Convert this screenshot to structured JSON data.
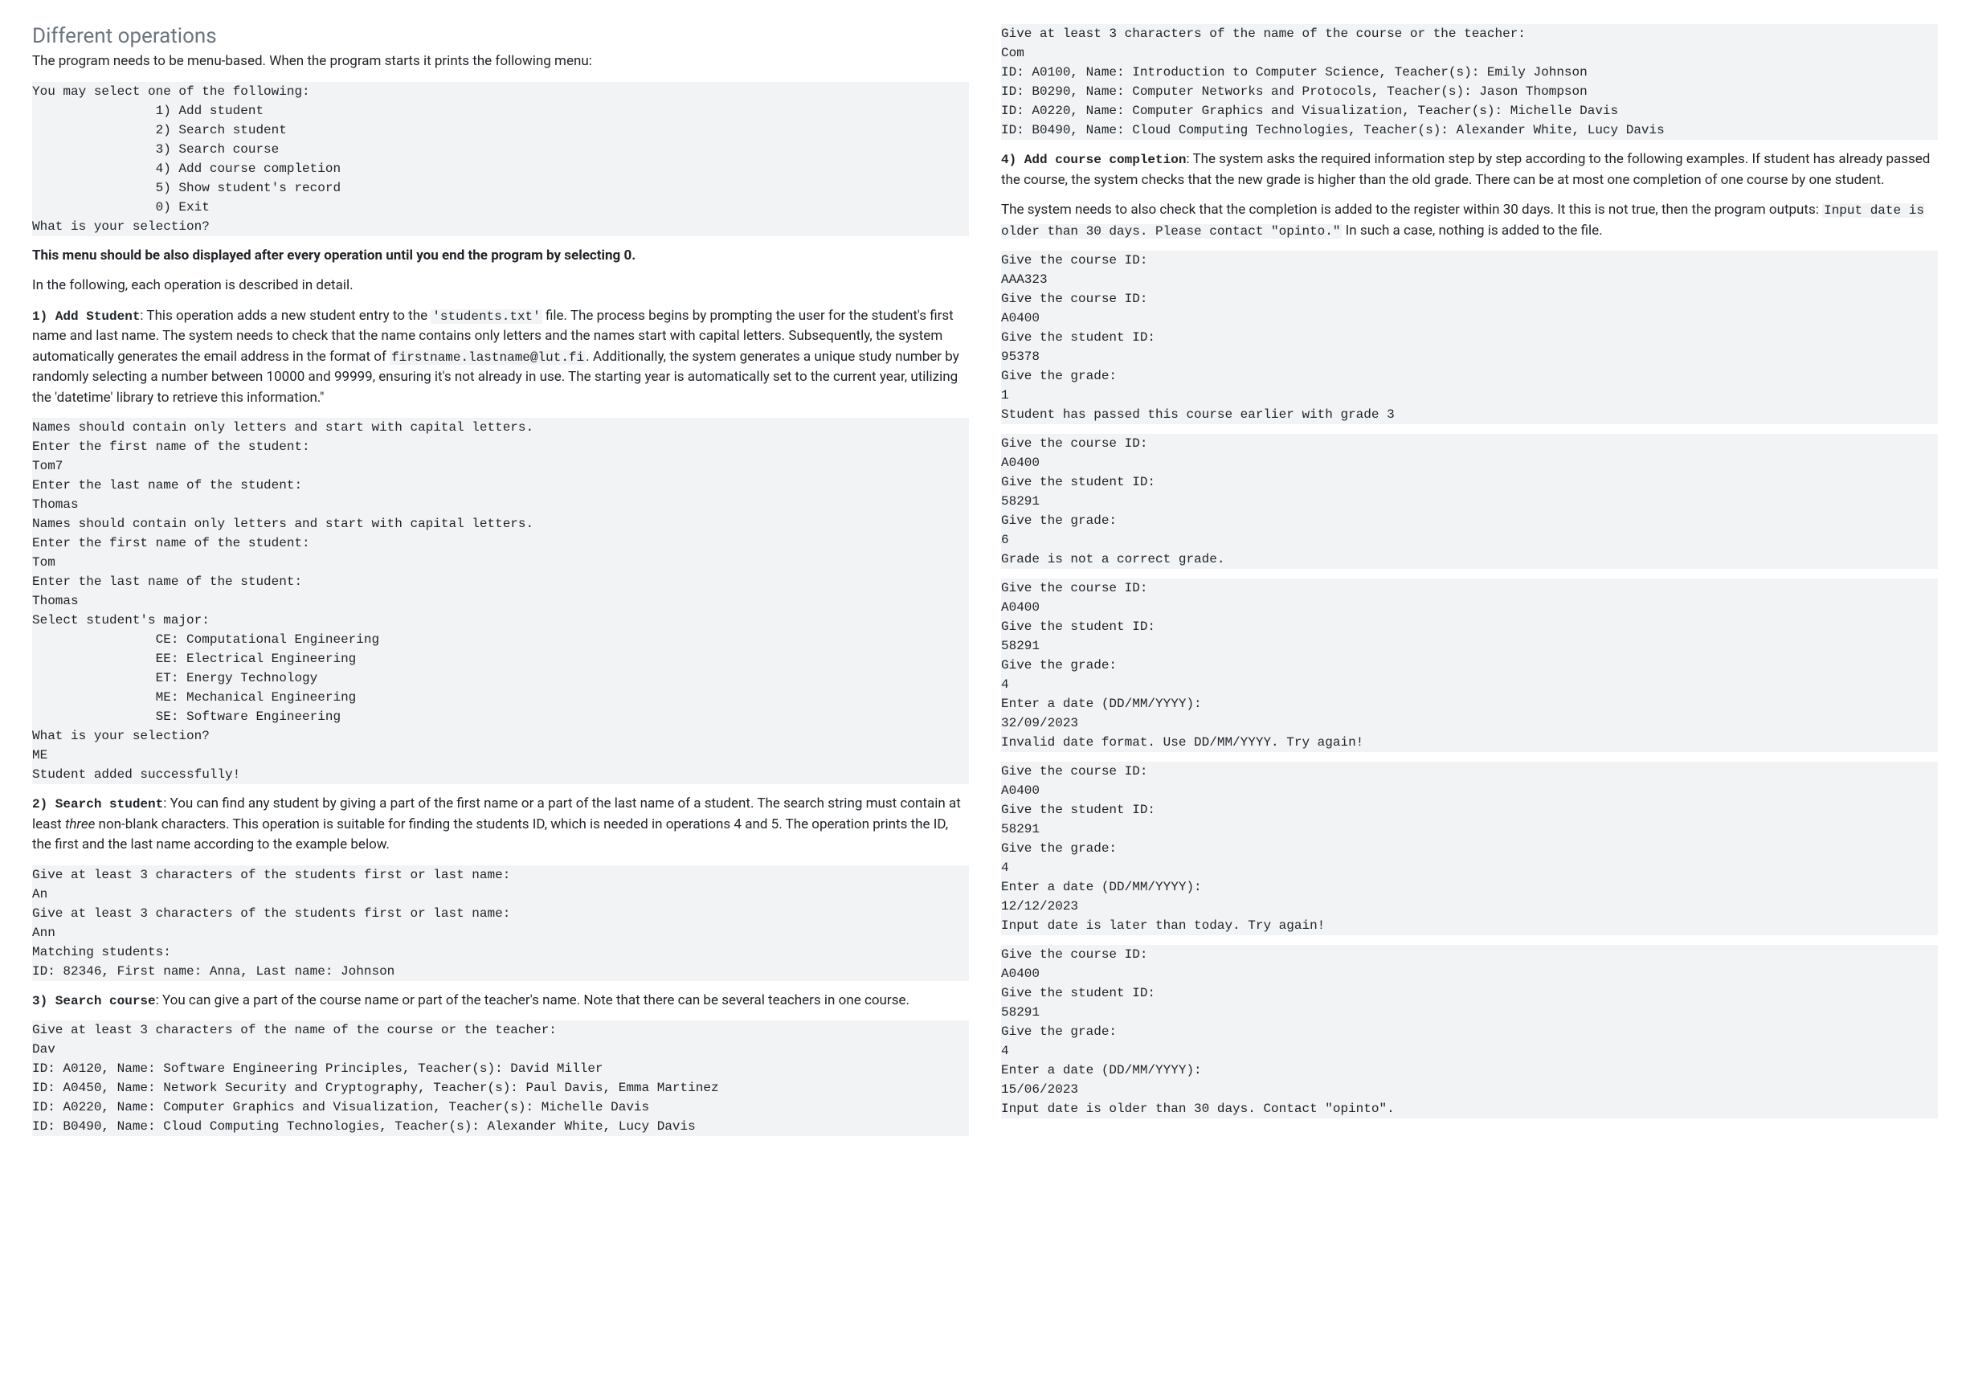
{
  "title": "Different operations",
  "intro": "The program needs to be menu-based. When the program starts it prints the following menu:",
  "menu_code": "You may select one of the following:\n                1) Add student\n                2) Search student\n                3) Search course\n                4) Add course completion\n                5) Show student's record\n                0) Exit\nWhat is your selection?",
  "menu_note": "This menu should be also displayed after every operation until you end the program by selecting 0.",
  "detail_intro": "In the following, each operation is described in detail.",
  "s1_lead": "1) Add Student",
  "s1_t1": ": This operation adds a new student entry to the ",
  "s1_file": "'students.txt'",
  "s1_t2": " file. The process begins by prompting the user for the student's first name and last name. The system needs to check that the name contains only letters and the names start with capital letters. Subsequently, the system automatically generates the email address in the format of ",
  "s1_fmt": "firstname.lastname@lut.fi",
  "s1_t3": ". Additionally, the system generates a unique study number by randomly selecting a number between 10000 and 99999, ensuring it's not already in use. The starting year is automatically set to the current year, utilizing the 'datetime' library to retrieve this information.\"",
  "s1_code": "Names should contain only letters and start with capital letters.\nEnter the first name of the student:\nTom7\nEnter the last name of the student:\nThomas\nNames should contain only letters and start with capital letters.\nEnter the first name of the student:\nTom\nEnter the last name of the student:\nThomas\nSelect student's major:\n                CE: Computational Engineering\n                EE: Electrical Engineering\n                ET: Energy Technology\n                ME: Mechanical Engineering\n                SE: Software Engineering\nWhat is your selection?\nME\nStudent added successfully!",
  "s2_lead": "2) Search student",
  "s2_t1": ":  You can find any student by giving a part of the first name or a part of the last name of a student. The search string must contain at least ",
  "s2_three": "three",
  "s2_t2": " non-blank characters. This operation is suitable for finding the students ID, which is needed in operations 4 and 5. The operation prints the ID, the first and the last name according to the example below.",
  "s2_code": "Give at least 3 characters of the students first or last name:\nAn\nGive at least 3 characters of the students first or last name:\nAnn\nMatching students:\nID: 82346, First name: Anna, Last name: Johnson",
  "s3_lead": "3) Search course",
  "s3_t1": ": You can give a part of the course name or part of the teacher's name. Note that there can be several teachers in one course.",
  "s3_code": "Give at least 3 characters of the name of the course or the teacher:\nDav\nID: A0120, Name: Software Engineering Principles, Teacher(s): David Miller\nID: A0450, Name: Network Security and Cryptography, Teacher(s): Paul Davis, Emma Martinez\nID: A0220, Name: Computer Graphics and Visualization, Teacher(s): Michelle Davis\nID: B0490, Name: Cloud Computing Technologies, Teacher(s): Alexander White, Lucy Davis",
  "s3_code2": "Give at least 3 characters of the name of the course or the teacher:\nCom\nID: A0100, Name: Introduction to Computer Science, Teacher(s): Emily Johnson\nID: B0290, Name: Computer Networks and Protocols, Teacher(s): Jason Thompson\nID: A0220, Name: Computer Graphics and Visualization, Teacher(s): Michelle Davis\nID: B0490, Name: Cloud Computing Technologies, Teacher(s): Alexander White, Lucy Davis",
  "s4_lead": "4) Add course completion",
  "s4_t1": ":  The system asks the required information step by step according to the following examples. If student has already passed the course, the system checks that the new grade is higher than the old grade. There can be at most one completion of one course by one student.",
  "s4_t2a": "The system needs to also check that the completion is added to the register within 30 days. It this is not true, then the program outputs: ",
  "s4_inline": "Input date is older than 30 days. Please contact \"opinto.\"",
  "s4_t2b": " In such a case, nothing is added to the file.",
  "s4_code1": "Give the course ID:\nAAA323\nGive the course ID:\nA0400\nGive the student ID:\n95378\nGive the grade:\n1\nStudent has passed this course earlier with grade 3",
  "s4_code2": "Give the course ID:\nA0400\nGive the student ID:\n58291\nGive the grade:\n6\nGrade is not a correct grade.",
  "s4_code3": "Give the course ID:\nA0400\nGive the student ID:\n58291\nGive the grade:\n4\nEnter a date (DD/MM/YYYY):\n32/09/2023\nInvalid date format. Use DD/MM/YYYY. Try again!",
  "s4_code4": "Give the course ID:\nA0400\nGive the student ID:\n58291\nGive the grade:\n4\nEnter a date (DD/MM/YYYY):\n12/12/2023\nInput date is later than today. Try again!",
  "s4_code5": "Give the course ID:\nA0400\nGive the student ID:\n58291\nGive the grade:\n4\nEnter a date (DD/MM/YYYY):\n15/06/2023\nInput date is older than 30 days. Contact \"opinto\"."
}
